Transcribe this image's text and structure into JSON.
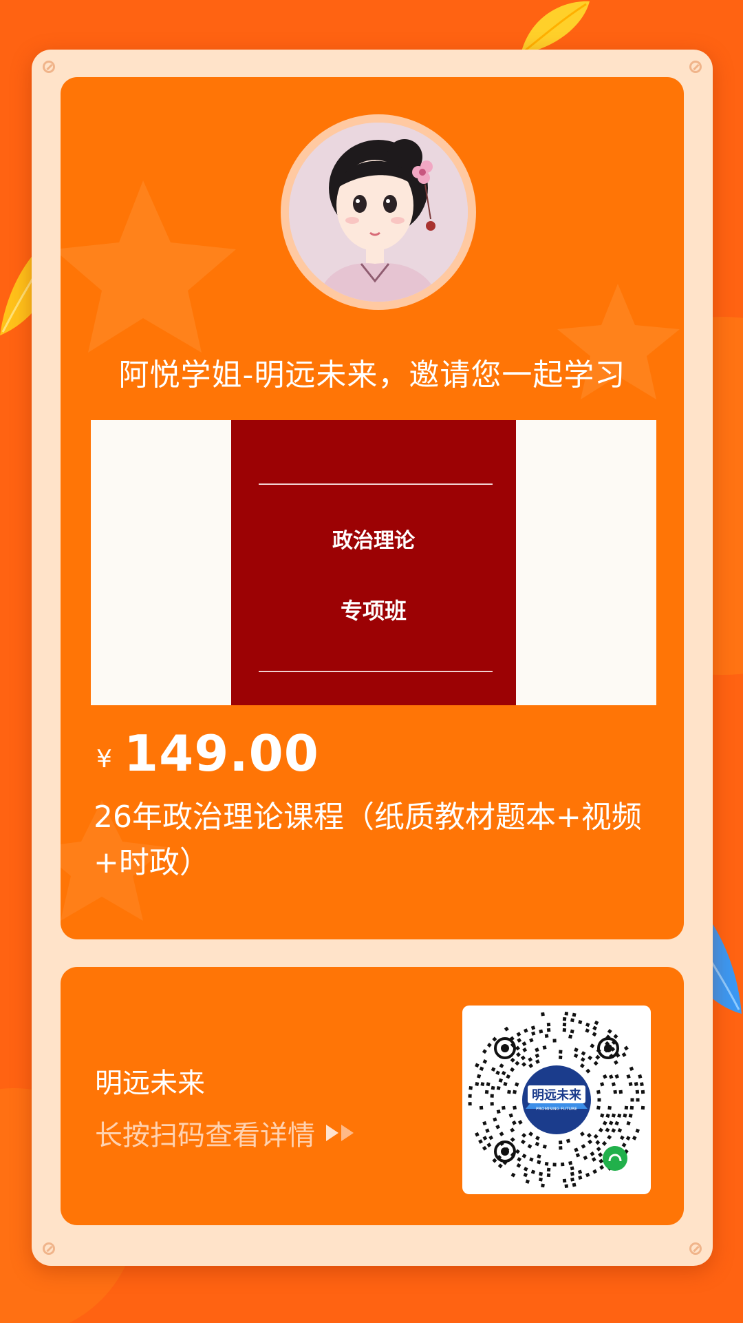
{
  "colors": {
    "background": "#ff6a10",
    "card": "#ff7506",
    "frame": "#ffe3c9",
    "banner_red": "#9c0204",
    "white": "#ffffff",
    "hint": "#ffd2b0",
    "leaf_yellow": "#ffd02a",
    "leaf_blue": "#2f8ff0"
  },
  "icons": {
    "avatar": "avatar-illustration-icon",
    "arrow": "double-play-arrow-icon",
    "qr": "mini-program-qr-code-icon",
    "qr_logo": "mingyuan-future-logo-icon",
    "mini_program": "wechat-mini-program-icon"
  },
  "invite": {
    "text": "阿悦学姐-明远未来，邀请您一起学习"
  },
  "banner": {
    "title": "政治理论",
    "subtitle": "专项班"
  },
  "product": {
    "currency": "¥",
    "price": "149.00",
    "title": "26年政治理论课程（纸质教材题本+视频+时政）"
  },
  "shop": {
    "name": "明远未来",
    "hint": "长按扫码查看详情"
  },
  "qr": {
    "logo_text": "明远未来",
    "logo_sub": "PROMISING FUTURE"
  }
}
